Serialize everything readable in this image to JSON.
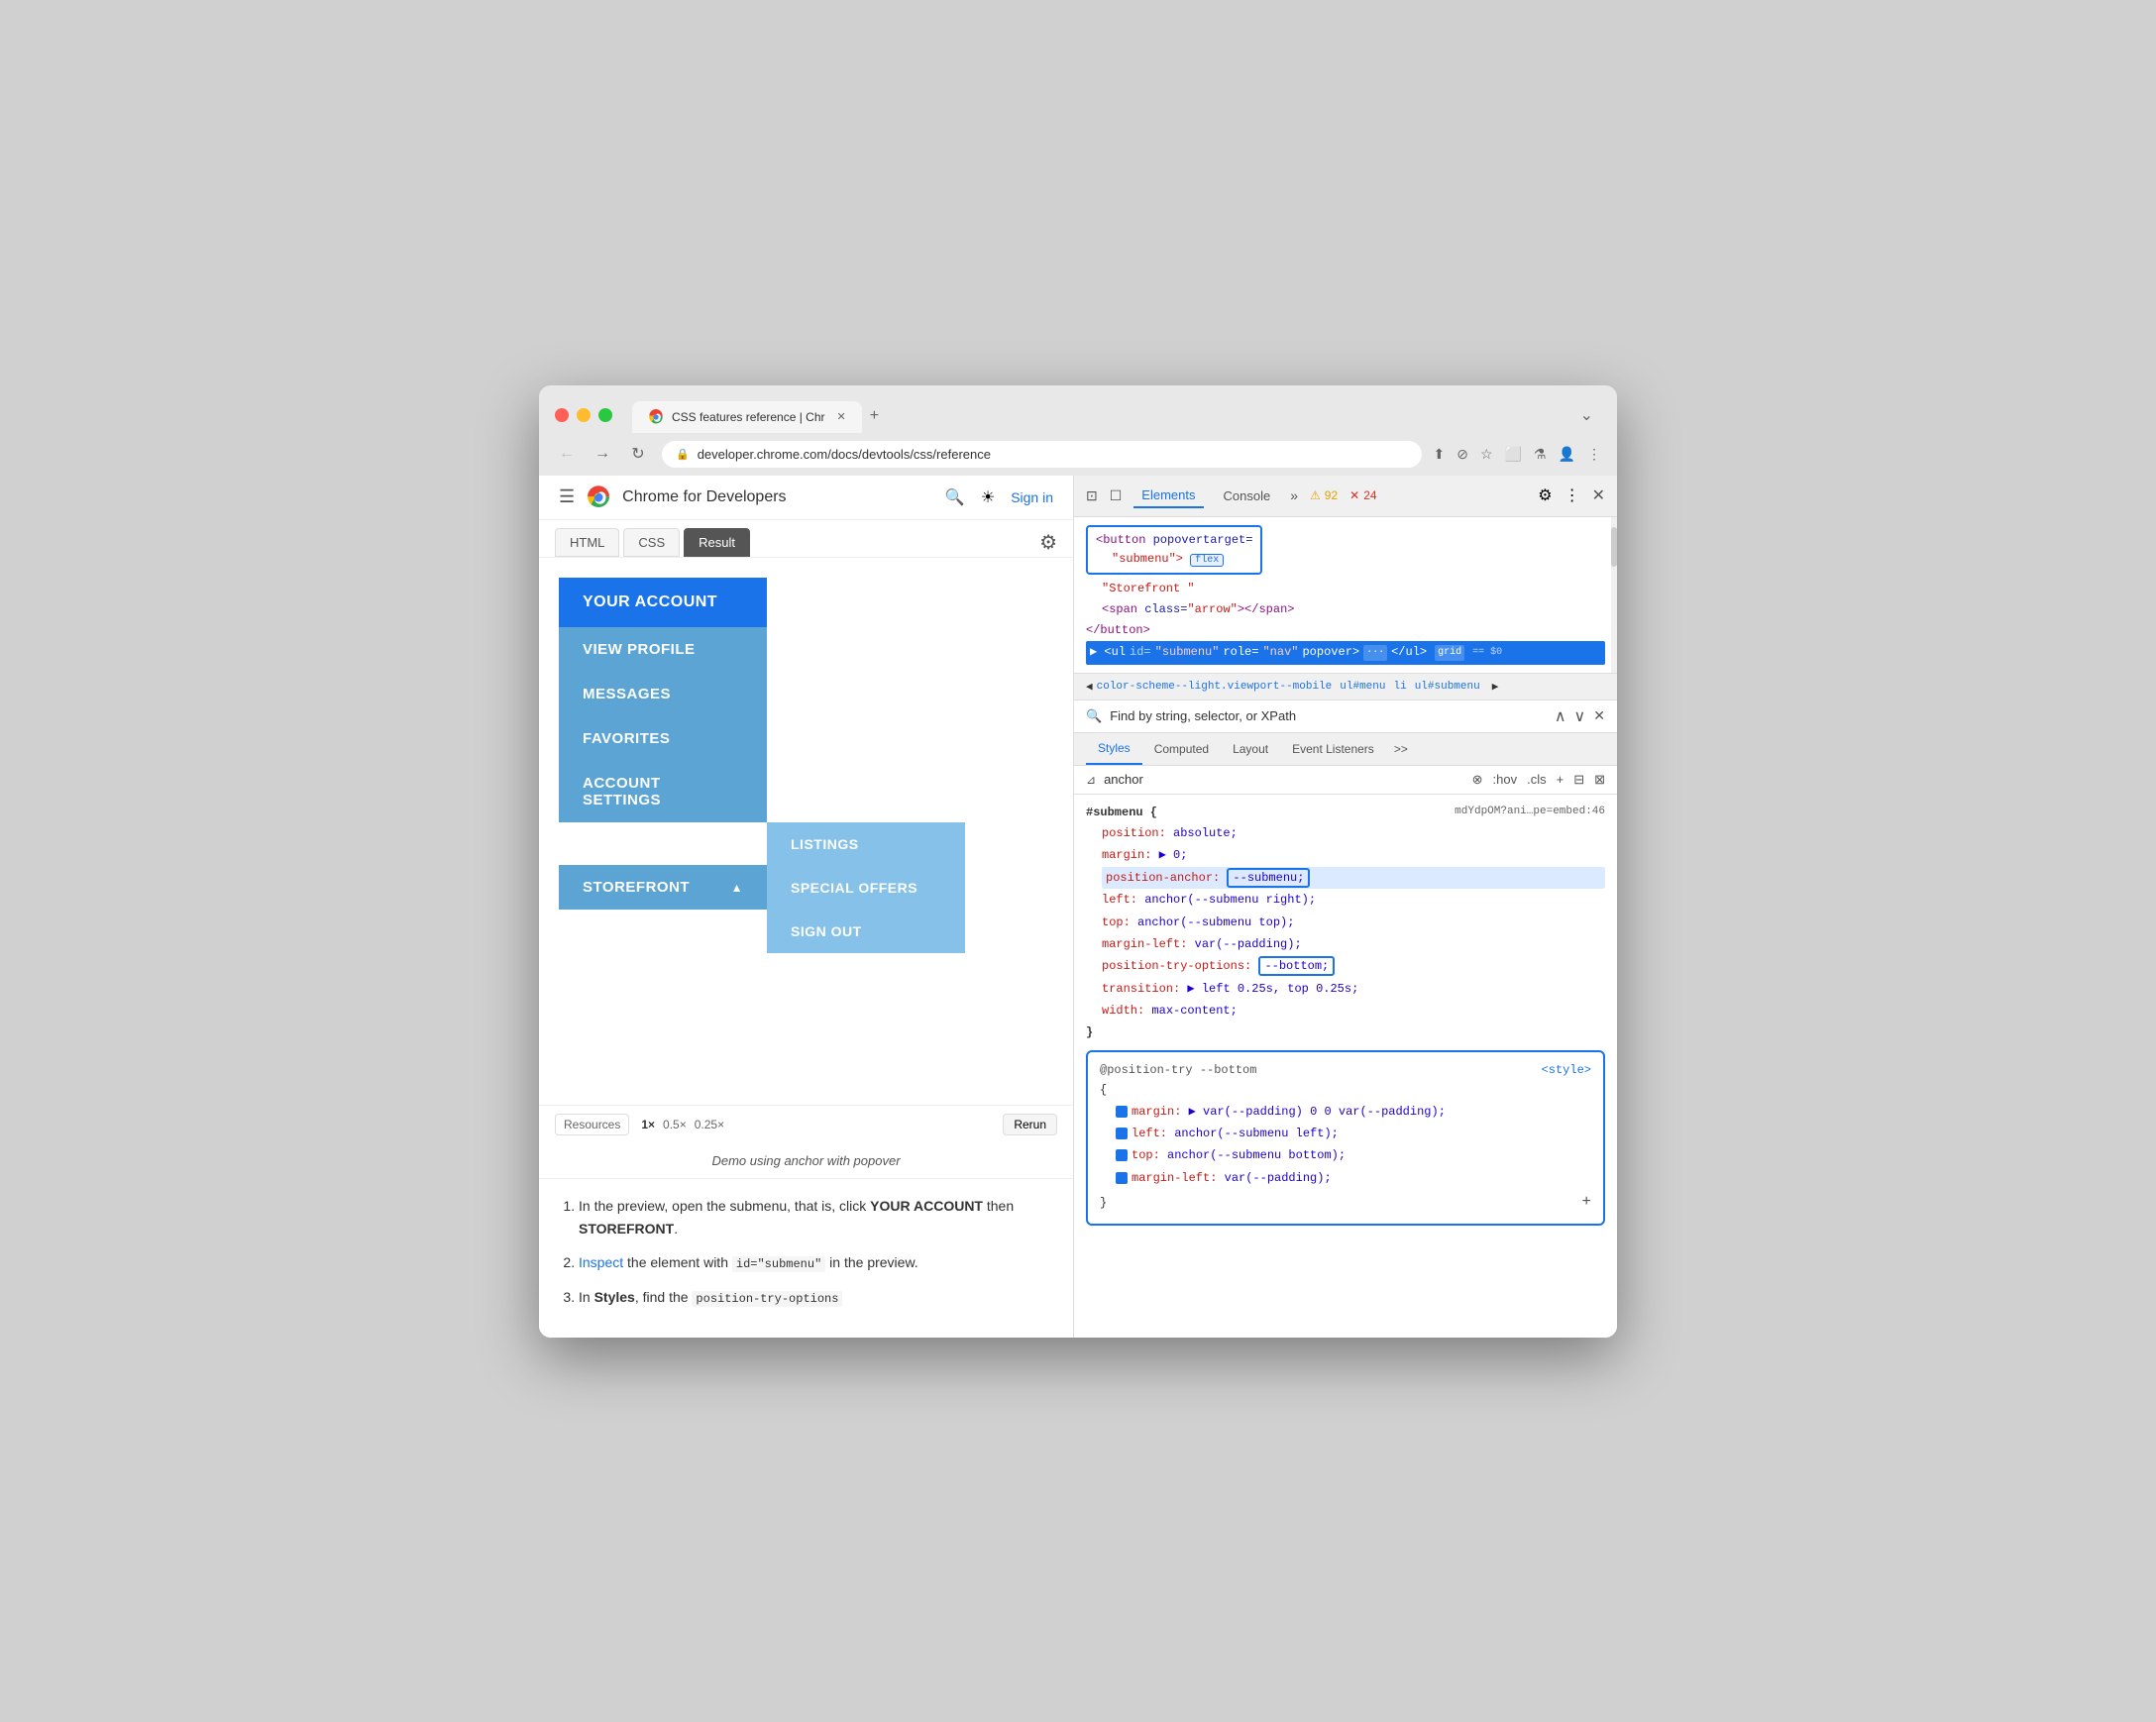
{
  "browser": {
    "title": "CSS features reference | Chr",
    "tab_close": "✕",
    "tab_new": "+",
    "tab_end": "⌄",
    "nav_back": "←",
    "nav_forward": "→",
    "nav_refresh": "↻",
    "address": "developer.chrome.com/docs/devtools/css/reference",
    "address_icon": "🔒",
    "toolbar_icons": [
      "⬆",
      "⊘",
      "☆",
      "⬜",
      "⚗",
      "👤",
      "⋮"
    ]
  },
  "site": {
    "hamburger": "☰",
    "name": "Chrome for Developers",
    "search_icon": "🔍",
    "theme_icon": "☀",
    "signin": "Sign in"
  },
  "code_tabs": {
    "html": "HTML",
    "css": "CSS",
    "result": "Result",
    "active": "Result",
    "settings_icon": "⚙"
  },
  "preview": {
    "your_account": "YOUR ACCOUNT",
    "view_profile": "VIEW PROFILE",
    "messages": "MESSAGES",
    "favorites": "FAVORITES",
    "account_settings": "ACCOUNT SETTINGS",
    "storefront": "STOREFRONT",
    "storefront_arrow": "▲",
    "listings": "LISTINGS",
    "special_offers": "SPECIAL OFFERS",
    "sign_out": "SIGN OUT"
  },
  "resource_bar": {
    "resources": "Resources",
    "zoom_1x": "1×",
    "zoom_05x": "0.5×",
    "zoom_025x": "0.25×",
    "rerun": "Rerun"
  },
  "demo_desc": "Demo using anchor with  popover",
  "instructions": {
    "item1_prefix": "In the preview, open the submenu, that is, click ",
    "item1_bold1": "YOUR ACCOUNT",
    "item1_mid": " then ",
    "item1_bold2": "STOREFRONT",
    "item1_suffix": ".",
    "item2_link": "Inspect",
    "item2_mid": " the element with ",
    "item2_code": "id=\"submenu\"",
    "item2_suffix": " in the preview.",
    "item3_prefix": "In ",
    "item3_bold": "Styles",
    "item3_suffix": ", find the ",
    "item3_code": "position-try-options"
  },
  "devtools": {
    "toolbar": {
      "selector_icon": "⊡",
      "device_icon": "☐",
      "elements": "Elements",
      "console": "Console",
      "more": "»",
      "warning_count": "92",
      "error_count": "24",
      "settings_icon": "⚙",
      "more_icon": "⋮",
      "close_icon": "✕"
    },
    "elements": {
      "line1_open": "<button popovertarget=",
      "line1_value": "\"submenu\">",
      "line1_badge": "flex",
      "line2": "\"Storefront \"",
      "line3_open": "<span class=",
      "line3_value": "\"arrow\">",
      "line3_close": "</span>",
      "line4": "</button>",
      "line5_open": "▶ <ul id=",
      "line5_id": "\"submenu\"",
      "line5_role": "role=",
      "line5_roleval": "\"nav\"",
      "line5_popover": "popover>",
      "line5_dots": "···",
      "line5_close": "</ul>",
      "line5_badge": "grid",
      "line5_eq": "== $0"
    },
    "breadcrumb": {
      "item1": "color-scheme--light.viewport--mobile",
      "item2": "ul#menu",
      "item3": "li",
      "item4": "ul#submenu",
      "arrow_prev": "◀",
      "arrow_next": "▶"
    },
    "search": {
      "placeholder": "Find by string, selector, or XPath",
      "arrow_up": "∧",
      "arrow_down": "∨",
      "close": "✕"
    },
    "styles_tabs": {
      "styles": "Styles",
      "computed": "Computed",
      "layout": "Layout",
      "event_listeners": "Event Listeners",
      "more": ">>"
    },
    "filter": {
      "icon": "⊿",
      "text": "anchor",
      "clear_icon": "⊗",
      "hov": ":hov",
      "cls": ".cls",
      "plus": "+",
      "layout_icon": "⊟",
      "computed_icon": "⊠"
    },
    "css_rule": {
      "selector": "#submenu {",
      "source": "mdYdpOM?ani…pe=embed:46",
      "props": [
        {
          "prop": "position:",
          "value": "absolute;"
        },
        {
          "prop": "margin:",
          "value": "▶ 0;"
        },
        {
          "prop": "position-anchor:",
          "value": "--submenu;",
          "highlighted": true
        },
        {
          "prop": "left:",
          "value": "anchor(--submenu right);"
        },
        {
          "prop": "top:",
          "value": "anchor(--submenu top);"
        },
        {
          "prop": "margin-left:",
          "value": "var(--padding);"
        },
        {
          "prop": "position-try-options:",
          "value": "--bottom;",
          "highlighted": true
        },
        {
          "prop": "transition:",
          "value": "▶ left 0.25s, top 0.25s;"
        },
        {
          "prop": "width:",
          "value": "max-content;"
        }
      ],
      "close": "}"
    },
    "position_try": {
      "selector": "@position-try --bottom",
      "open": "{",
      "source": "<style>",
      "props": [
        {
          "prop": "margin:",
          "value": "▶ var(--padding) 0 0 var(--padding);"
        },
        {
          "prop": "left:",
          "value": "anchor(--submenu left);"
        },
        {
          "prop": "top:",
          "value": "anchor(--submenu bottom);"
        },
        {
          "prop": "margin-left:",
          "value": "var(--padding);"
        }
      ],
      "close": "}",
      "add_rule": "+"
    }
  },
  "colors": {
    "blue_primary": "#1a73e8",
    "menu_dark": "#1a73e8",
    "menu_medium": "#5ba4d4",
    "menu_light": "#85c1e9",
    "annotation_arrow": "#1a4db8"
  }
}
